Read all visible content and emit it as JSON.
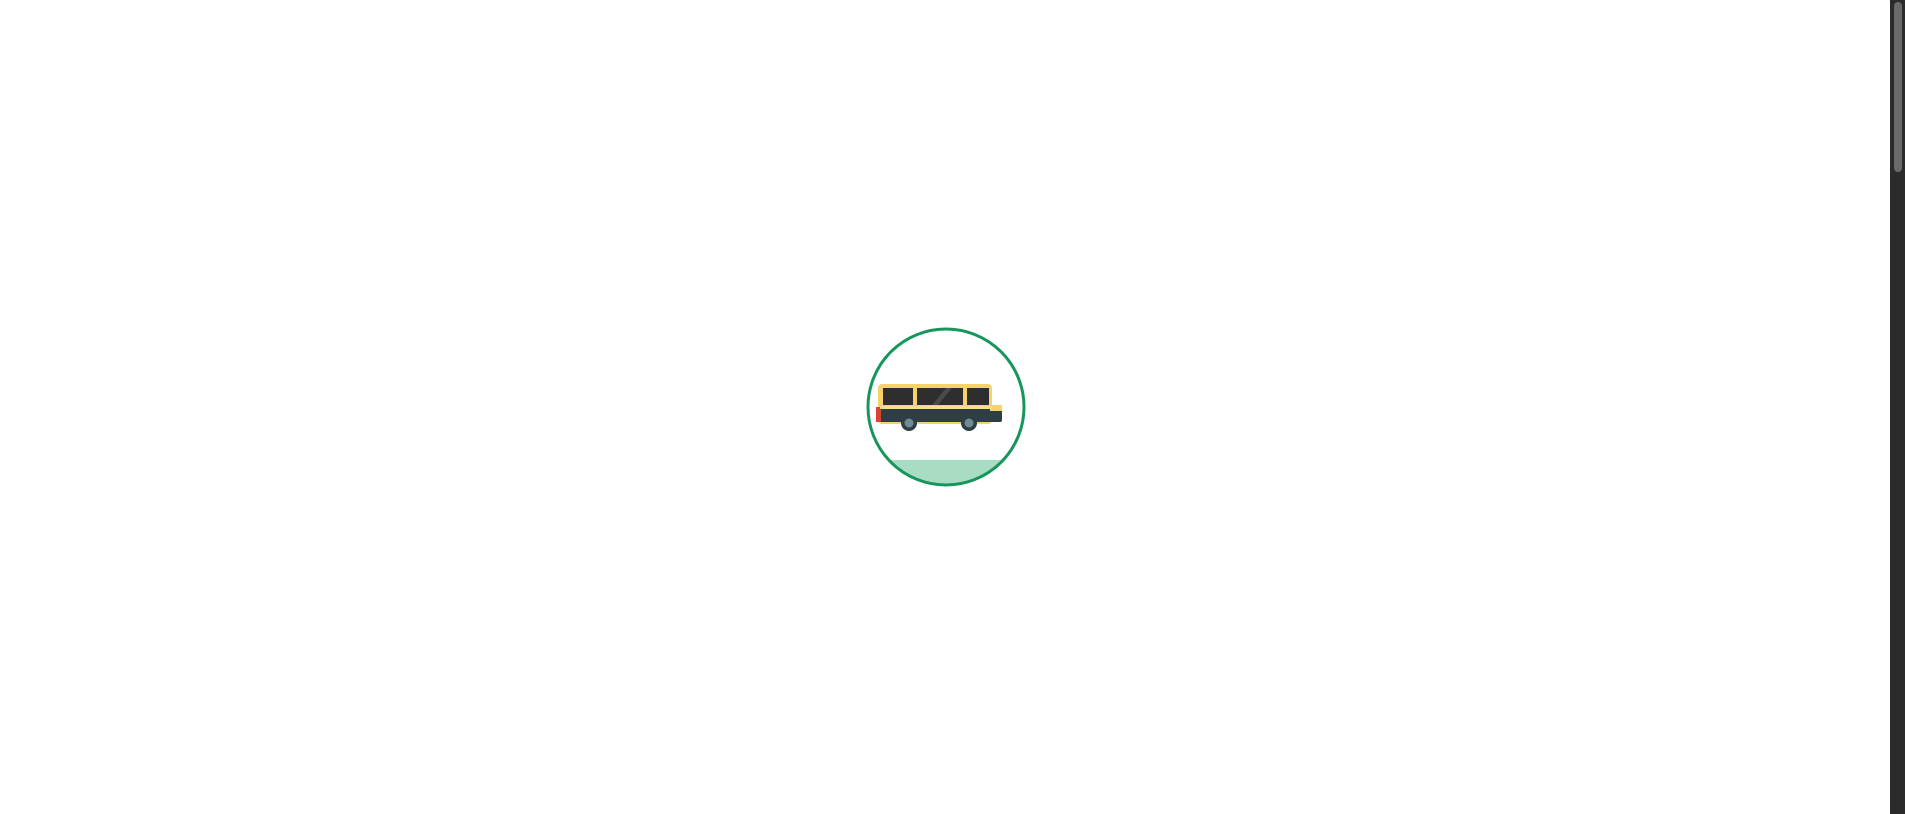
{
  "loader": {
    "icon": "bus-icon",
    "ring_color": "#16965a",
    "road_color": "#a8dcc3",
    "bus_body_color": "#f6d36a",
    "bus_dark_color": "#2f3e45",
    "bus_window_color": "#2e2e2e",
    "bus_tail_color": "#d9462f"
  },
  "scrollbar": {
    "position_fraction": 0.0
  }
}
